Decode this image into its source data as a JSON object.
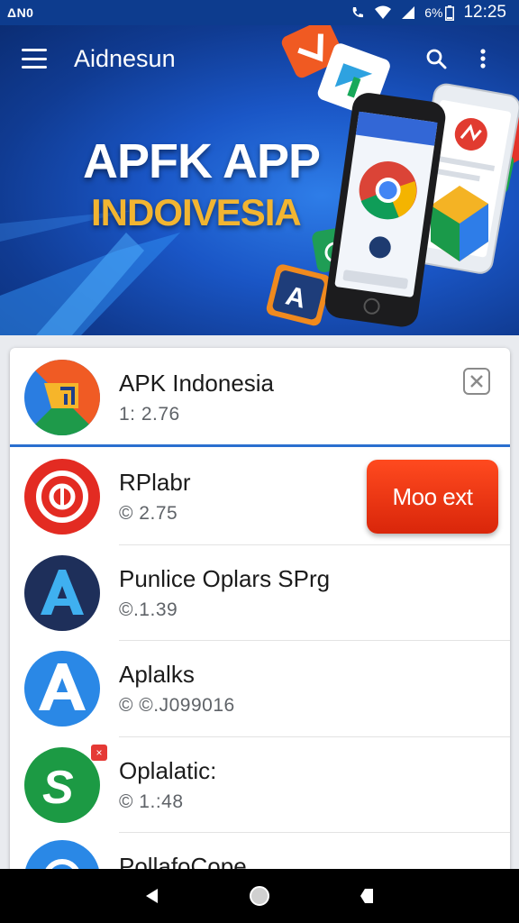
{
  "status_bar": {
    "left_text": "ΔΝ0",
    "time": "12:25",
    "battery_label": "6%",
    "icons": [
      "wifi-calling-icon",
      "wifi-icon",
      "signal-icon",
      "battery-icon"
    ]
  },
  "app_bar": {
    "title": "Aidnesun",
    "icons": [
      "menu-icon",
      "search-icon",
      "more-vert-icon"
    ]
  },
  "banner": {
    "title": "APFK APP",
    "subtitle": "INDOIVESIA",
    "colors": {
      "title": "#ffffff",
      "subtitle": "#f2b531",
      "background": "#1a56c6"
    }
  },
  "list": {
    "items": [
      {
        "title": "APK Indonesia",
        "version": "1: 2.76",
        "icon": "apk-indonesia-icon",
        "icon_color": "#2a7de1"
      },
      {
        "title": "RPlabr",
        "version": "© 2.75",
        "icon": "target-icon",
        "icon_color": "#e32b22"
      },
      {
        "title": "Punlice  Oplars SPrg",
        "version": "©.1.39",
        "icon": "letter-a-icon",
        "icon_color": "#1e2f5a"
      },
      {
        "title": "Aplalks",
        "version": "© ©.J099016",
        "icon": "letter-a-icon",
        "icon_color": "#2a88e6"
      },
      {
        "title": "Oplalatic:",
        "version": "© 1.:48",
        "icon": "letter-s-icon",
        "icon_color": "#1c9a44"
      },
      {
        "title": "PollafoCope",
        "version": "",
        "icon": "circle-icon",
        "icon_color": "#2a88e6"
      }
    ],
    "action_button_label": "Moo ext",
    "action_button_color": "#e8300f",
    "accent_line_color": "#2a6fcf"
  },
  "nav_bar": {
    "icons": [
      "back-icon",
      "home-icon",
      "recents-icon"
    ]
  }
}
